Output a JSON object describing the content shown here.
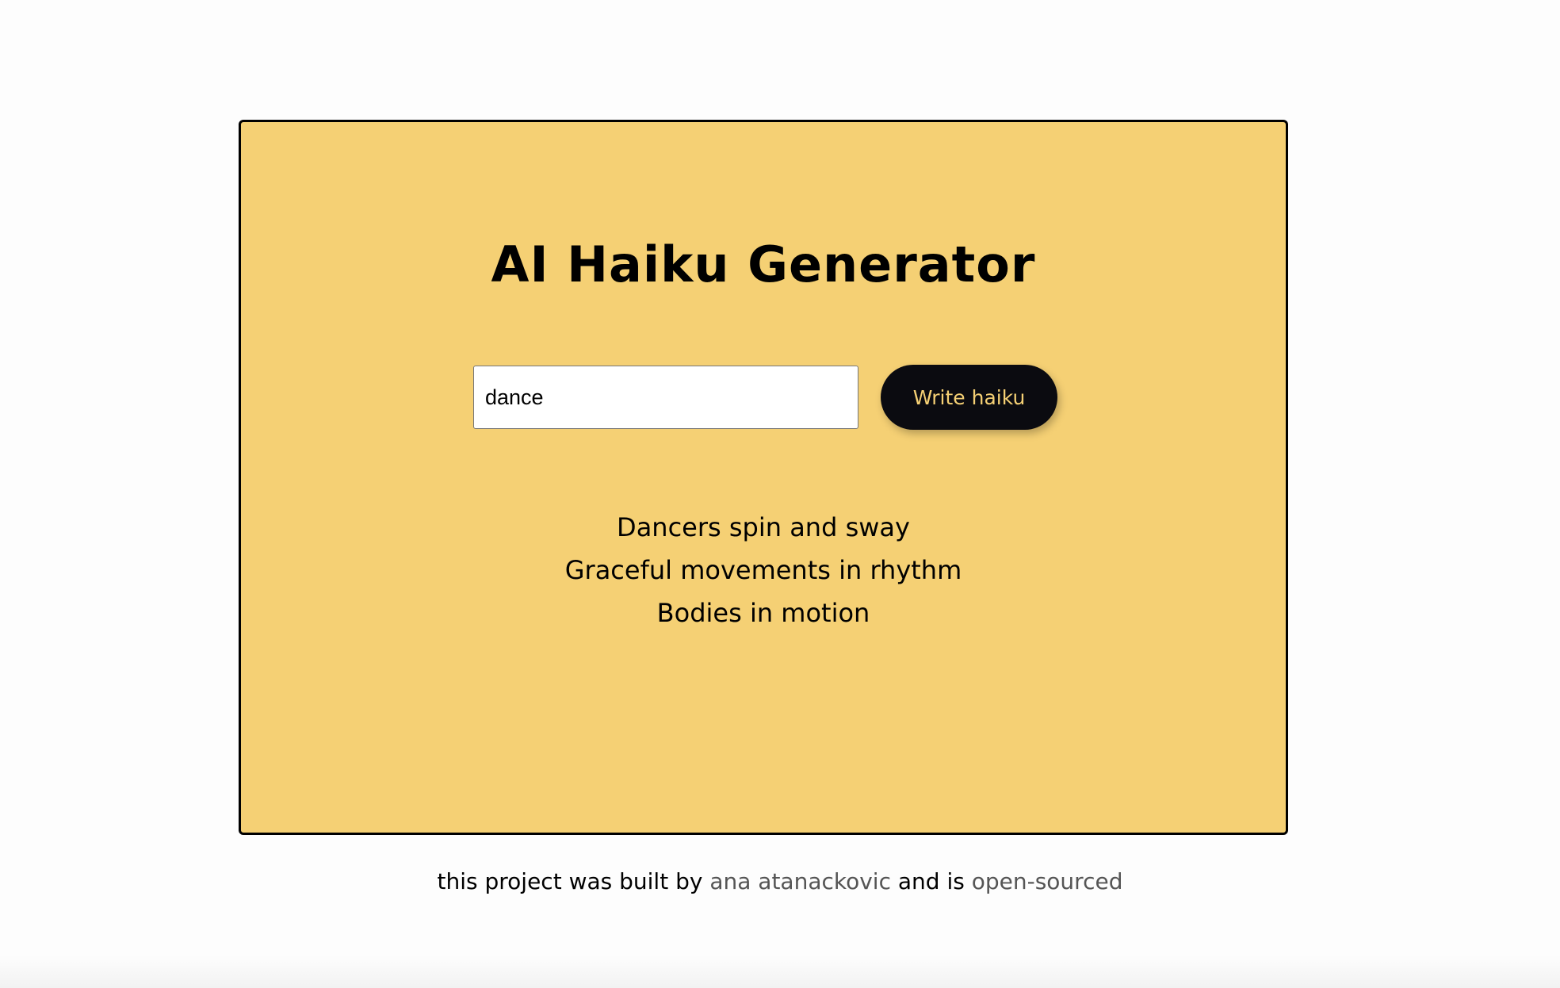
{
  "card": {
    "title": "AI Haiku Generator",
    "input_value": "dance",
    "button_label": "Write haiku",
    "haiku_lines": [
      "Dancers spin and sway",
      "Graceful movements in rhythm",
      "Bodies in motion"
    ]
  },
  "footer": {
    "text_before": "this project was built by ",
    "author_link": "ana atanackovic",
    "text_middle": " and is ",
    "source_link": "open-sourced"
  },
  "colors": {
    "card_background": "#f5d074",
    "button_background": "#0b0b10",
    "button_text": "#f5d074",
    "link_text": "#555555"
  }
}
